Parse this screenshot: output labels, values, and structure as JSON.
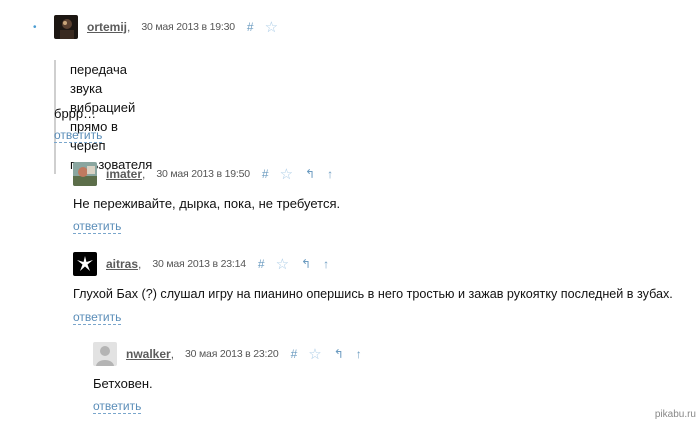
{
  "bullet": "•",
  "comments": [
    {
      "author": "ortemij",
      "date": "30 мая 2013 в 19:30",
      "hash": "#",
      "quote": "передача звука вибрацией прямо в череп пользователя",
      "text": "бррр…",
      "reply_label": "ответить",
      "avatar": "dark-photo"
    },
    {
      "author": "imater",
      "date": "30 мая 2013 в 19:50",
      "hash": "#",
      "parent_glyph": "↰",
      "up_glyph": "↑",
      "text": "Не переживайте, дырка, пока, не требуется.",
      "reply_label": "ответить",
      "avatar": "photo"
    },
    {
      "author": "aitras",
      "date": "30 мая 2013 в 23:14",
      "hash": "#",
      "parent_glyph": "↰",
      "up_glyph": "↑",
      "text": "Глухой Бах (?) слушал игру на пианино опершись в него тростью и зажав рукоятку последней в зубах.",
      "reply_label": "ответить",
      "avatar": "black-logo"
    },
    {
      "author": "nwalker",
      "date": "30 мая 2013 в 23:20",
      "hash": "#",
      "parent_glyph": "↰",
      "up_glyph": "↑",
      "text": "Бетховен.",
      "reply_label": "ответить",
      "avatar": "default-user"
    }
  ],
  "star_glyph": "☆",
  "watermark": "pikabu.ru",
  "colors": {
    "link": "#5a8db8",
    "icon": "#6b9bc0",
    "star": "#a9cbe6",
    "author": "#5b5b5b"
  }
}
